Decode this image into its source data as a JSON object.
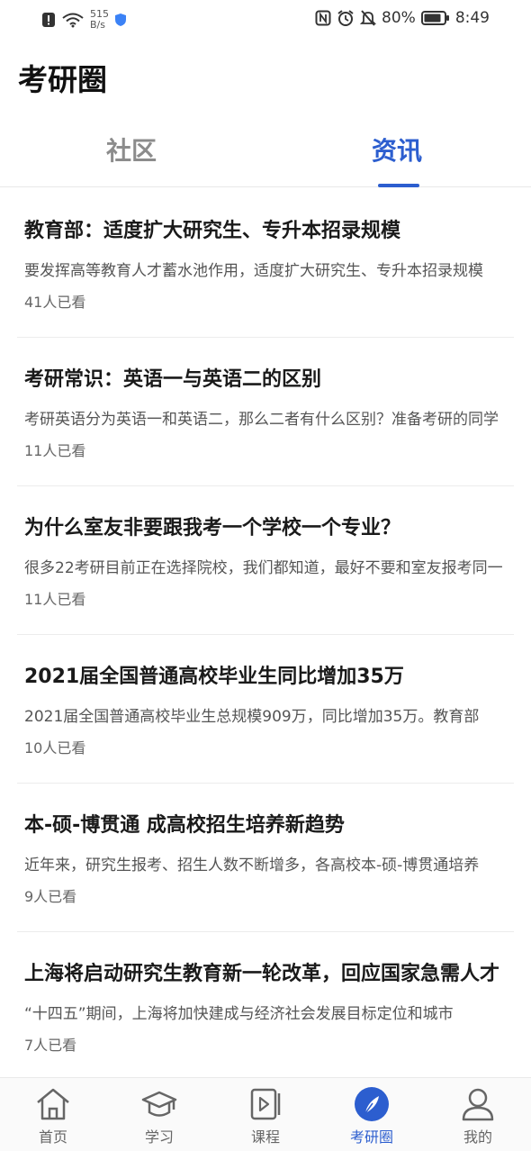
{
  "status_bar": {
    "net_speed_value": "515",
    "net_speed_unit": "B/s",
    "battery": "80%",
    "time": "8:49"
  },
  "page": {
    "title": "考研圈"
  },
  "tabs": [
    {
      "label": "社区",
      "active": false
    },
    {
      "label": "资讯",
      "active": true
    }
  ],
  "articles": [
    {
      "title": "教育部：适度扩大研究生、专升本招录规模",
      "summary": "要发挥高等教育人才蓄水池作用，适度扩大研究生、专升本招录规模",
      "views": "41人已看"
    },
    {
      "title": "考研常识：英语一与英语二的区别",
      "summary": "考研英语分为英语一和英语二，那么二者有什么区别？准备考研的同学",
      "views": "11人已看"
    },
    {
      "title": "为什么室友非要跟我考一个学校一个专业？",
      "summary": "很多22考研目前正在选择院校，我们都知道，最好不要和室友报考同一",
      "views": "11人已看"
    },
    {
      "title": "2021届全国普通高校毕业生同比增加35万",
      "summary": "2021届全国普通高校毕业生总规模909万，同比增加35万。教育部",
      "views": "10人已看"
    },
    {
      "title": "本-硕-博贯通 成高校招生培养新趋势",
      "summary": "近年来，研究生报考、招生人数不断增多，各高校本-硕-博贯通培养",
      "views": "9人已看"
    },
    {
      "title": "上海将启动研究生教育新一轮改革，回应国家急需人才",
      "summary": "“十四五”期间，上海将加快建成与经济社会发展目标定位和城市",
      "views": "7人已看"
    }
  ],
  "bottom_nav": [
    {
      "label": "首页",
      "icon": "home-icon"
    },
    {
      "label": "学习",
      "icon": "graduation-cap-icon"
    },
    {
      "label": "课程",
      "icon": "video-course-icon"
    },
    {
      "label": "考研圈",
      "icon": "compass-icon",
      "active": true
    },
    {
      "label": "我的",
      "icon": "profile-icon"
    }
  ],
  "colors": {
    "accent": "#2c5ecf",
    "inactive_tab": "#8c8c8c"
  }
}
